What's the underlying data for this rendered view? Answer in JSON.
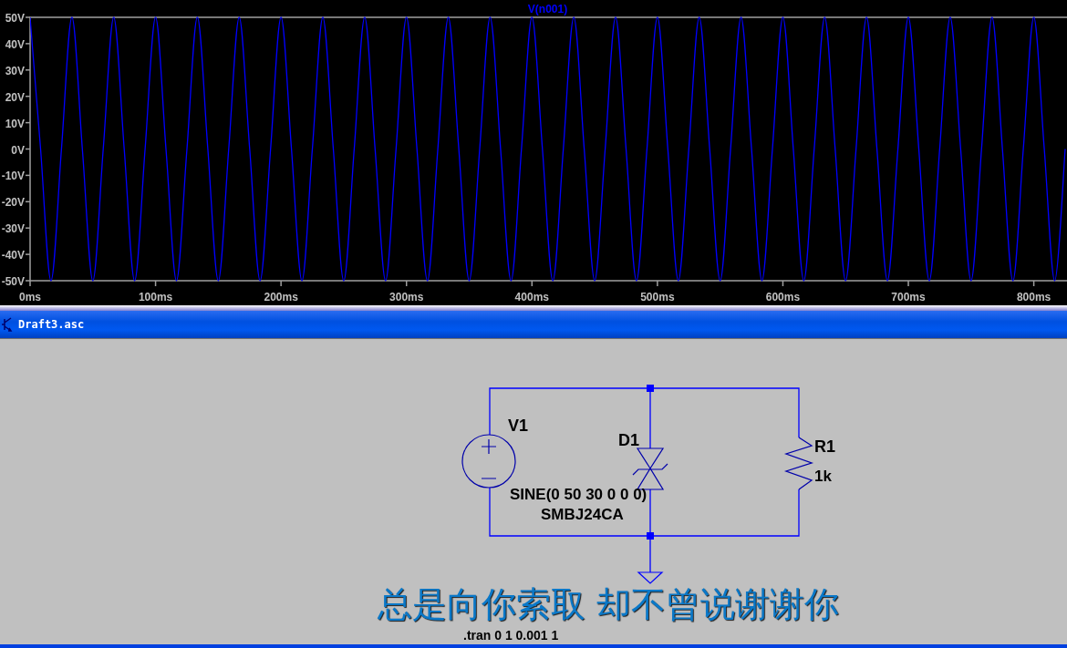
{
  "plot": {
    "chart_data": {
      "type": "line",
      "title": "V(n001)",
      "xlim": [
        0,
        825
      ],
      "ylim": [
        -50,
        50
      ],
      "xticks": [
        {
          "value": 0,
          "label": "0ms"
        },
        {
          "value": 100,
          "label": "100ms"
        },
        {
          "value": 200,
          "label": "200ms"
        },
        {
          "value": 300,
          "label": "300ms"
        },
        {
          "value": 400,
          "label": "400ms"
        },
        {
          "value": 500,
          "label": "500ms"
        },
        {
          "value": 600,
          "label": "600ms"
        },
        {
          "value": 700,
          "label": "700ms"
        },
        {
          "value": 800,
          "label": "800ms"
        }
      ],
      "yticks": [
        {
          "value": 50,
          "label": "50V"
        },
        {
          "value": 40,
          "label": "40V"
        },
        {
          "value": 30,
          "label": "30V"
        },
        {
          "value": 20,
          "label": "20V"
        },
        {
          "value": 10,
          "label": "10V"
        },
        {
          "value": 0,
          "label": "0V"
        },
        {
          "value": -10,
          "label": "-10V"
        },
        {
          "value": -20,
          "label": "-20V"
        },
        {
          "value": -30,
          "label": "-30V"
        },
        {
          "value": -40,
          "label": "-40V"
        },
        {
          "value": -50,
          "label": "-50V"
        }
      ],
      "x": [
        0,
        8.33,
        16.67,
        25,
        33.33,
        41.67,
        50,
        58.33,
        66.67,
        75,
        83.33,
        91.67,
        100,
        108.33,
        116.67,
        125,
        133.33,
        141.67,
        150,
        158.33,
        166.67,
        175,
        183.33,
        191.67,
        200,
        208.33,
        216.67,
        225,
        233.33,
        241.67,
        250,
        258.33,
        266.67,
        275,
        283.33,
        291.67,
        300,
        308.33,
        316.67,
        325,
        333.33,
        341.67,
        350,
        358.33,
        366.67,
        375,
        383.33,
        391.67,
        400,
        408.33,
        416.67,
        425,
        433.33,
        441.67,
        450,
        458.33,
        466.67,
        475,
        483.33,
        491.67,
        500,
        508.33,
        516.67,
        525,
        533.33,
        541.67,
        550,
        558.33,
        566.67,
        575,
        583.33,
        591.67,
        600,
        608.33,
        616.67,
        625,
        633.33,
        641.67,
        650,
        658.33,
        666.67,
        675,
        683.33,
        691.67,
        700,
        708.33,
        716.67,
        725,
        733.33,
        741.67,
        750,
        758.33,
        766.67,
        775,
        783.33,
        791.67,
        800,
        808.33,
        816.67,
        825
      ],
      "series": [
        {
          "color": "#0000ff",
          "values": [
            50,
            0,
            -50,
            0,
            50,
            0,
            -50,
            0,
            50,
            0,
            -50,
            0,
            50,
            0,
            -50,
            0,
            50,
            0,
            -50,
            0,
            50,
            0,
            -50,
            0,
            50,
            0,
            -50,
            0,
            50,
            0,
            -50,
            0,
            50,
            0,
            -50,
            0,
            50,
            0,
            -50,
            0,
            50,
            0,
            -50,
            0,
            50,
            0,
            -50,
            0,
            50,
            0,
            -50,
            0,
            50,
            0,
            -50,
            0,
            50,
            0,
            -50,
            0,
            50,
            0,
            -50,
            0,
            50,
            0,
            -50,
            0,
            50,
            0,
            -50,
            0,
            50,
            0,
            -50,
            0,
            50,
            0,
            -50,
            0,
            50,
            0,
            -50,
            0,
            50,
            0,
            -50,
            0,
            50,
            0,
            -50,
            0,
            50,
            0,
            -50,
            0,
            50,
            0,
            -50,
            0
          ]
        }
      ]
    }
  },
  "window": {
    "title": "Draft3.asc"
  },
  "schematic": {
    "labels": [
      {
        "text": "V1",
        "kind": "ref"
      },
      {
        "text": "D1",
        "kind": "ref"
      },
      {
        "text": "R1",
        "kind": "ref"
      },
      {
        "text": "1k",
        "kind": "value"
      },
      {
        "text": "SINE(0 50 30 0 0 0)",
        "kind": "value"
      },
      {
        "text": "SMBJ24CA",
        "kind": "value"
      },
      {
        "text": ".tran 0 1 0.001 1",
        "kind": "directive"
      }
    ]
  },
  "subtitle": "总是向你索取 却不曾说谢谢你"
}
